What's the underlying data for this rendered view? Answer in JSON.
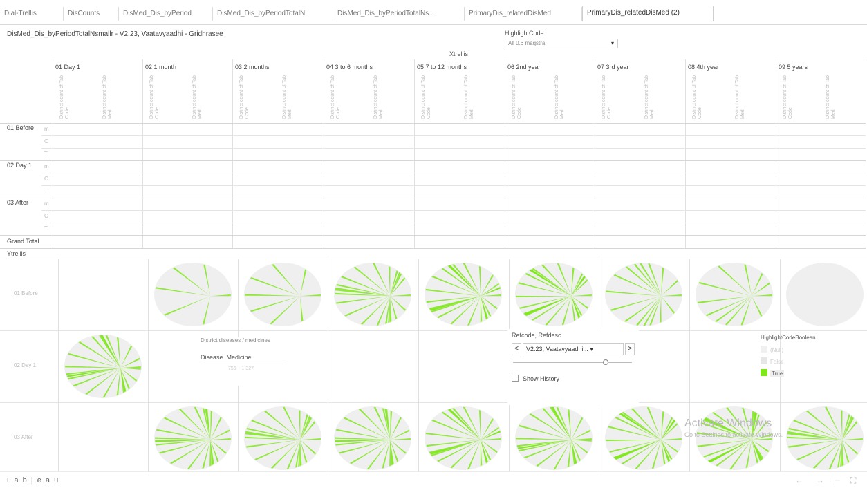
{
  "tabs": [
    "Dial-Trellis",
    "DisCounts",
    "DisMed_Dis_byPeriod",
    "DisMed_Dis_byPeriodTotalN",
    "DisMed_Dis_byPeriodTotalNs...",
    "PrimaryDis_relatedDisMed",
    "PrimaryDis_relatedDisMed (2)"
  ],
  "active_tab_index": 6,
  "sheet_title": "DisMed_Dis_byPeriodTotalNsmallr - V2.23, Vaatavyaadhi - Gridhrasee",
  "highlight": {
    "label": "HighlightCode",
    "value": "All 0.6 maqstra"
  },
  "xtrellis_label": "Xtrellis",
  "ytrellis_label": "Ytrellis",
  "columns": [
    "01 Day 1",
    "02 1 month",
    "03 2 months",
    "04 3 to 6 months",
    "05 7 to 12 months",
    "06 2nd year",
    "07 3rd year",
    "08 4th year",
    "09 5 years"
  ],
  "measures": [
    "Distinct count of Tab Code",
    "Distinct count of Tab Med"
  ],
  "row_groups": [
    {
      "label": "01 Before",
      "sub": [
        "m",
        "O",
        "T"
      ]
    },
    {
      "label": "02 Day 1",
      "sub": [
        "m",
        "O",
        "T"
      ]
    },
    {
      "label": "03 After",
      "sub": [
        "m",
        "O",
        "T"
      ]
    }
  ],
  "grand_total_label": "Grand Total",
  "trellis_rows": [
    "01 Before",
    "02 Day 1",
    "03 After"
  ],
  "dist_popup": {
    "title": "District diseases / medicines",
    "col1": "Disease",
    "col2": "Medicine",
    "v1": "756",
    "v2": "1,327"
  },
  "refcode": {
    "label": "Refcode, Refdesc",
    "value": "V2.23, Vaatavyaadhi...",
    "prev": "<",
    "next": ">",
    "history": "Show History"
  },
  "legend": {
    "title": "HighlightCodeBoolean",
    "items": [
      {
        "label": "(Null)",
        "color": "#f0f0f0"
      },
      {
        "label": "False",
        "color": "#e6e6e6"
      },
      {
        "label": "True",
        "color": "#7fe81a"
      }
    ]
  },
  "watermark": {
    "line1": "Activate Windows",
    "line2": "Go to Settings to activate Windows."
  },
  "footer": {
    "logo": "+ a b | e a u",
    "icons": [
      "undo-icon",
      "redo-icon",
      "revert-icon",
      "fullscreen-icon"
    ]
  },
  "colors": {
    "accent": "#7fe81a",
    "grid": "#e4e4e4",
    "pie_bg": "#efefef"
  }
}
